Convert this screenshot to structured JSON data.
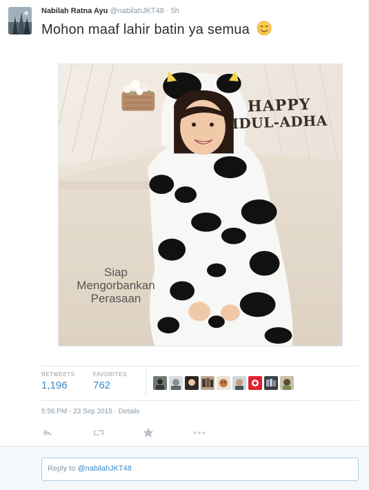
{
  "tweet": {
    "author_name": "Nabilah Ratna Ayu",
    "author_handle": "@nabilahJKT48",
    "separator": "·",
    "age": "5h",
    "text": "Mohon maaf lahir batin ya semua",
    "emoji": "smiling-face-emoji"
  },
  "media": {
    "greeting_line1": "HAPPY",
    "greeting_line2": "IDUL-ADHA",
    "caption_line1": "Siap",
    "caption_line2": "Mengorbankan",
    "caption_line3": "Perasaan"
  },
  "stats": {
    "retweets_label": "RETWEETS",
    "retweets_count": "1,196",
    "favorites_label": "FAVORITES",
    "favorites_count": "762"
  },
  "meta": {
    "timestamp": "5:56 PM - 23 Sep 2015",
    "separator": "·",
    "details": "Details"
  },
  "actions": [
    "reply-icon",
    "retweet-icon",
    "favorite-icon",
    "more-icon"
  ],
  "reply": {
    "prefix": "Reply to ",
    "mention": "@nabilahJKT48"
  },
  "colors": {
    "link": "#3b88c3",
    "muted": "#8899a6",
    "text": "#292f33",
    "border": "#e1e8ed"
  }
}
